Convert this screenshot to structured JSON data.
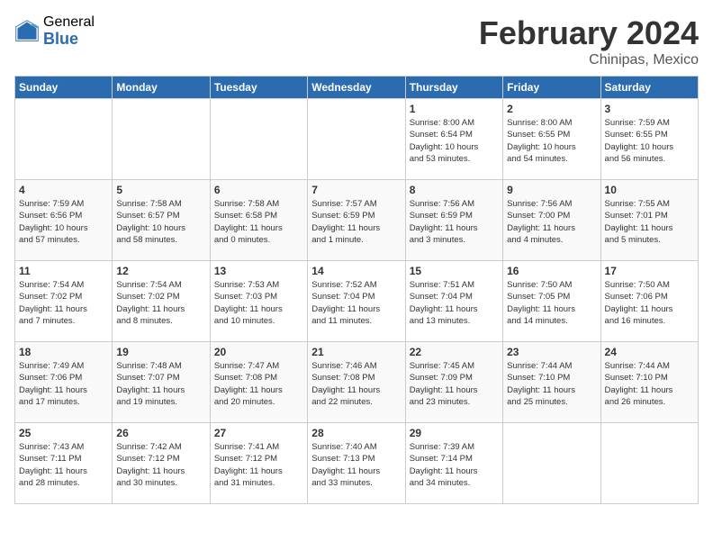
{
  "header": {
    "logo_general": "General",
    "logo_blue": "Blue",
    "title": "February 2024",
    "location": "Chinipas, Mexico"
  },
  "days_of_week": [
    "Sunday",
    "Monday",
    "Tuesday",
    "Wednesday",
    "Thursday",
    "Friday",
    "Saturday"
  ],
  "weeks": [
    [
      {
        "day": "",
        "detail": ""
      },
      {
        "day": "",
        "detail": ""
      },
      {
        "day": "",
        "detail": ""
      },
      {
        "day": "",
        "detail": ""
      },
      {
        "day": "1",
        "detail": "Sunrise: 8:00 AM\nSunset: 6:54 PM\nDaylight: 10 hours\nand 53 minutes."
      },
      {
        "day": "2",
        "detail": "Sunrise: 8:00 AM\nSunset: 6:55 PM\nDaylight: 10 hours\nand 54 minutes."
      },
      {
        "day": "3",
        "detail": "Sunrise: 7:59 AM\nSunset: 6:55 PM\nDaylight: 10 hours\nand 56 minutes."
      }
    ],
    [
      {
        "day": "4",
        "detail": "Sunrise: 7:59 AM\nSunset: 6:56 PM\nDaylight: 10 hours\nand 57 minutes."
      },
      {
        "day": "5",
        "detail": "Sunrise: 7:58 AM\nSunset: 6:57 PM\nDaylight: 10 hours\nand 58 minutes."
      },
      {
        "day": "6",
        "detail": "Sunrise: 7:58 AM\nSunset: 6:58 PM\nDaylight: 11 hours\nand 0 minutes."
      },
      {
        "day": "7",
        "detail": "Sunrise: 7:57 AM\nSunset: 6:59 PM\nDaylight: 11 hours\nand 1 minute."
      },
      {
        "day": "8",
        "detail": "Sunrise: 7:56 AM\nSunset: 6:59 PM\nDaylight: 11 hours\nand 3 minutes."
      },
      {
        "day": "9",
        "detail": "Sunrise: 7:56 AM\nSunset: 7:00 PM\nDaylight: 11 hours\nand 4 minutes."
      },
      {
        "day": "10",
        "detail": "Sunrise: 7:55 AM\nSunset: 7:01 PM\nDaylight: 11 hours\nand 5 minutes."
      }
    ],
    [
      {
        "day": "11",
        "detail": "Sunrise: 7:54 AM\nSunset: 7:02 PM\nDaylight: 11 hours\nand 7 minutes."
      },
      {
        "day": "12",
        "detail": "Sunrise: 7:54 AM\nSunset: 7:02 PM\nDaylight: 11 hours\nand 8 minutes."
      },
      {
        "day": "13",
        "detail": "Sunrise: 7:53 AM\nSunset: 7:03 PM\nDaylight: 11 hours\nand 10 minutes."
      },
      {
        "day": "14",
        "detail": "Sunrise: 7:52 AM\nSunset: 7:04 PM\nDaylight: 11 hours\nand 11 minutes."
      },
      {
        "day": "15",
        "detail": "Sunrise: 7:51 AM\nSunset: 7:04 PM\nDaylight: 11 hours\nand 13 minutes."
      },
      {
        "day": "16",
        "detail": "Sunrise: 7:50 AM\nSunset: 7:05 PM\nDaylight: 11 hours\nand 14 minutes."
      },
      {
        "day": "17",
        "detail": "Sunrise: 7:50 AM\nSunset: 7:06 PM\nDaylight: 11 hours\nand 16 minutes."
      }
    ],
    [
      {
        "day": "18",
        "detail": "Sunrise: 7:49 AM\nSunset: 7:06 PM\nDaylight: 11 hours\nand 17 minutes."
      },
      {
        "day": "19",
        "detail": "Sunrise: 7:48 AM\nSunset: 7:07 PM\nDaylight: 11 hours\nand 19 minutes."
      },
      {
        "day": "20",
        "detail": "Sunrise: 7:47 AM\nSunset: 7:08 PM\nDaylight: 11 hours\nand 20 minutes."
      },
      {
        "day": "21",
        "detail": "Sunrise: 7:46 AM\nSunset: 7:08 PM\nDaylight: 11 hours\nand 22 minutes."
      },
      {
        "day": "22",
        "detail": "Sunrise: 7:45 AM\nSunset: 7:09 PM\nDaylight: 11 hours\nand 23 minutes."
      },
      {
        "day": "23",
        "detail": "Sunrise: 7:44 AM\nSunset: 7:10 PM\nDaylight: 11 hours\nand 25 minutes."
      },
      {
        "day": "24",
        "detail": "Sunrise: 7:44 AM\nSunset: 7:10 PM\nDaylight: 11 hours\nand 26 minutes."
      }
    ],
    [
      {
        "day": "25",
        "detail": "Sunrise: 7:43 AM\nSunset: 7:11 PM\nDaylight: 11 hours\nand 28 minutes."
      },
      {
        "day": "26",
        "detail": "Sunrise: 7:42 AM\nSunset: 7:12 PM\nDaylight: 11 hours\nand 30 minutes."
      },
      {
        "day": "27",
        "detail": "Sunrise: 7:41 AM\nSunset: 7:12 PM\nDaylight: 11 hours\nand 31 minutes."
      },
      {
        "day": "28",
        "detail": "Sunrise: 7:40 AM\nSunset: 7:13 PM\nDaylight: 11 hours\nand 33 minutes."
      },
      {
        "day": "29",
        "detail": "Sunrise: 7:39 AM\nSunset: 7:14 PM\nDaylight: 11 hours\nand 34 minutes."
      },
      {
        "day": "",
        "detail": ""
      },
      {
        "day": "",
        "detail": ""
      }
    ]
  ]
}
